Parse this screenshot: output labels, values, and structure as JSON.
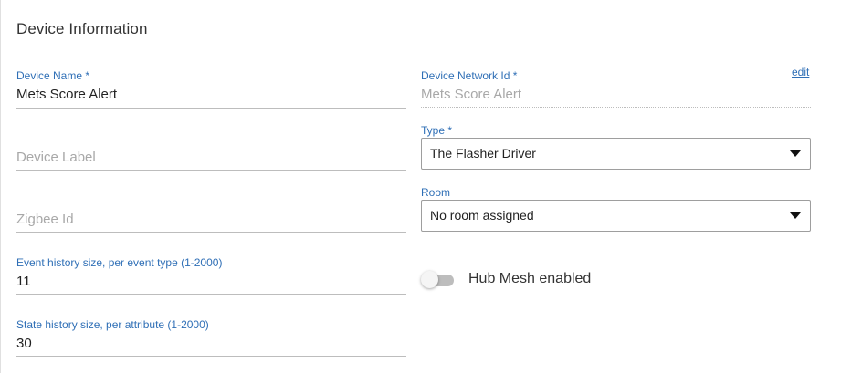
{
  "section": {
    "title": "Device Information"
  },
  "fields": {
    "device_name": {
      "label": "Device Name *",
      "value": "Mets Score Alert"
    },
    "device_label": {
      "placeholder": "Device Label"
    },
    "zigbee_id": {
      "placeholder": "Zigbee Id"
    },
    "event_history": {
      "label": "Event history size, per event type (1-2000)",
      "value": "11"
    },
    "state_history": {
      "label": "State history size, per attribute (1-2000)",
      "value": "30"
    },
    "network_id": {
      "label": "Device Network Id *",
      "value": "Mets Score Alert",
      "edit_label": "edit"
    },
    "type": {
      "label": "Type *",
      "selected": "The Flasher Driver"
    },
    "room": {
      "label": "Room",
      "selected": "No room assigned"
    }
  },
  "hub_mesh": {
    "label": "Hub Mesh enabled",
    "enabled": false
  },
  "colors": {
    "label_blue": "#2f6fb6",
    "text": "#222222",
    "placeholder": "#a8a8a8"
  }
}
